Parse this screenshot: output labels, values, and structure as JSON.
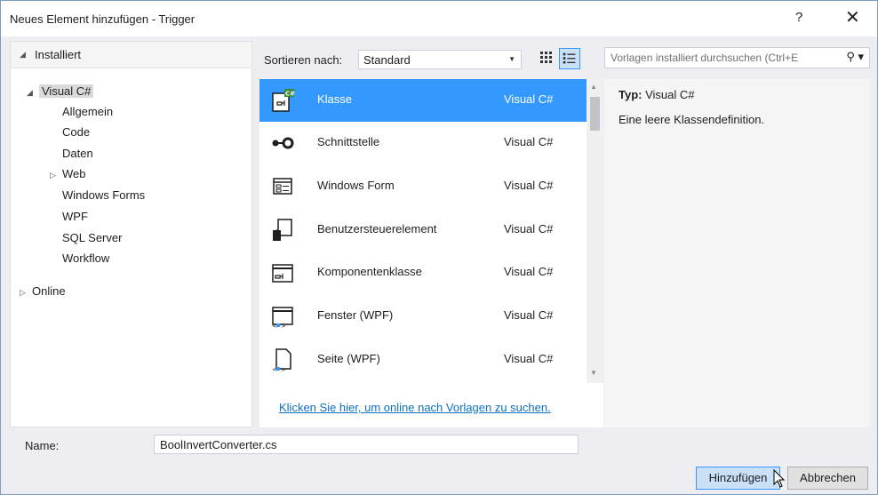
{
  "window": {
    "title": "Neues Element hinzufügen - Trigger",
    "help": "?",
    "close": "✕"
  },
  "tree": {
    "header": "Installiert",
    "root": "Visual C#",
    "items": [
      "Allgemein",
      "Code",
      "Daten",
      "Web",
      "Windows Forms",
      "WPF",
      "SQL Server",
      "Workflow"
    ],
    "online": "Online"
  },
  "toolbar": {
    "sort_label": "Sortieren nach:",
    "sort_value": "Standard",
    "search_placeholder": "Vorlagen installiert durchsuchen (Ctrl+E"
  },
  "templates": [
    {
      "name": "Klasse",
      "lang": "Visual C#",
      "icon": "class-icon",
      "selected": true
    },
    {
      "name": "Schnittstelle",
      "lang": "Visual C#",
      "icon": "interface-icon"
    },
    {
      "name": "Windows Form",
      "lang": "Visual C#",
      "icon": "windows-form-icon"
    },
    {
      "name": "Benutzersteuerelement",
      "lang": "Visual C#",
      "icon": "user-control-icon"
    },
    {
      "name": "Komponentenklasse",
      "lang": "Visual C#",
      "icon": "component-class-icon"
    },
    {
      "name": "Fenster (WPF)",
      "lang": "Visual C#",
      "icon": "wpf-window-icon"
    },
    {
      "name": "Seite (WPF)",
      "lang": "Visual C#",
      "icon": "wpf-page-icon"
    }
  ],
  "online_link": "Klicken Sie hier, um online nach Vorlagen zu suchen.",
  "details": {
    "type_label": "Typ:",
    "type_value": "Visual C#",
    "description": "Eine leere Klassendefinition."
  },
  "bottom": {
    "name_label": "Name:",
    "name_value": "BoolInvertConverter.cs",
    "add_button": "Hinzufügen",
    "cancel_button": "Abbrechen"
  },
  "colors": {
    "accent": "#3399ff",
    "link": "#0e70c0",
    "selection_bg": "#3399ff"
  }
}
